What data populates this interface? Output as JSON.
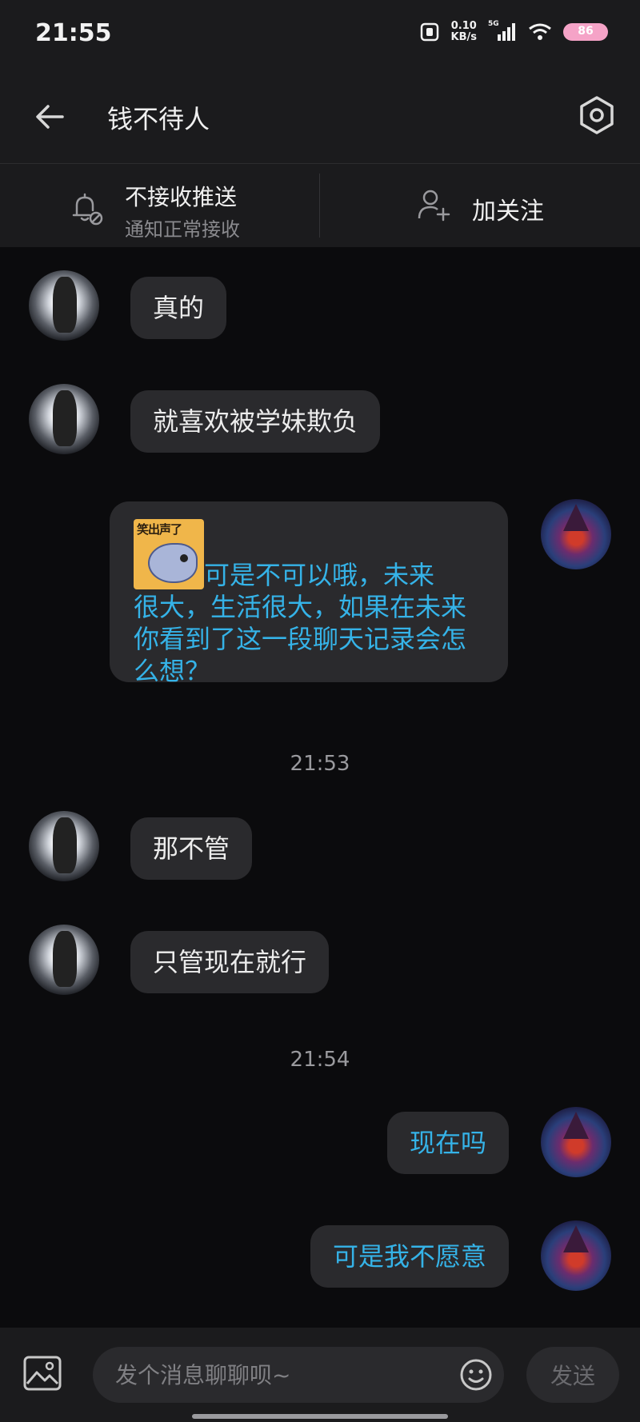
{
  "status_bar": {
    "time": "21:55",
    "speed_value": "0.10",
    "speed_unit": "KB/s",
    "network": "5G",
    "battery": "86"
  },
  "header": {
    "title": "钱不待人"
  },
  "actions": {
    "notify_title": "不接收推送",
    "notify_subtitle": "通知正常接收",
    "follow_label": "加关注"
  },
  "messages": [
    {
      "sender": "other",
      "text": "真的"
    },
    {
      "sender": "other",
      "text": "就喜欢被学妹欺负"
    },
    {
      "sender": "me",
      "sticker_text": "笑出声了",
      "text_line1": "可是不可以哦，未来",
      "text_rest": "很大，生活很大，如果在未来你看到了这一段聊天记录会怎么想？"
    },
    {
      "sender": "other",
      "text": "那不管"
    },
    {
      "sender": "other",
      "text": "只管现在就行"
    },
    {
      "sender": "me",
      "text": "现在吗"
    },
    {
      "sender": "me",
      "text": "可是我不愿意"
    }
  ],
  "timestamps": [
    "21:53",
    "21:54"
  ],
  "input": {
    "placeholder": "发个消息聊聊呗~",
    "send_label": "发送"
  },
  "colors": {
    "accent_text": "#35b3e8",
    "bubble_bg": "#2a2a2d",
    "background": "#0b0b0d"
  }
}
